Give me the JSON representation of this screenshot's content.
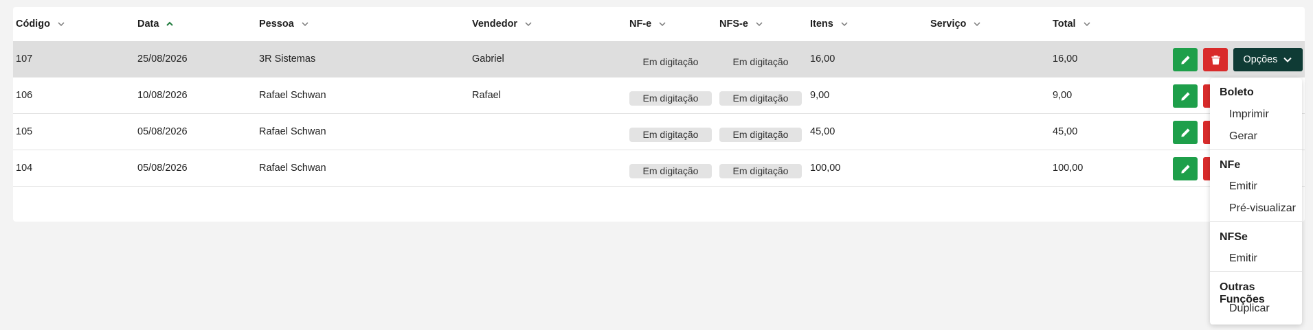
{
  "columns": {
    "codigo": "Código",
    "data": "Data",
    "pessoa": "Pessoa",
    "vendedor": "Vendedor",
    "nfe": "NF-e",
    "nfse": "NFS-e",
    "itens": "Itens",
    "servico": "Serviço",
    "total": "Total"
  },
  "sort": {
    "column": "data",
    "direction": "ascending"
  },
  "rows": [
    {
      "codigo": "107",
      "data": "25/08/2026",
      "pessoa": "3R Sistemas",
      "vendedor": "Gabriel",
      "nfe": "Em digitação",
      "nfse": "Em digitação",
      "itens": "16,00",
      "servico": "",
      "total": "16,00",
      "selected": true
    },
    {
      "codigo": "106",
      "data": "10/08/2026",
      "pessoa": "Rafael Schwan",
      "vendedor": "Rafael",
      "nfe": "Em digitação",
      "nfse": "Em digitação",
      "itens": "9,00",
      "servico": "",
      "total": "9,00"
    },
    {
      "codigo": "105",
      "data": "05/08/2026",
      "pessoa": "Rafael Schwan",
      "vendedor": "",
      "nfe": "Em digitação",
      "nfse": "Em digitação",
      "itens": "45,00",
      "servico": "",
      "total": "45,00"
    },
    {
      "codigo": "104",
      "data": "05/08/2026",
      "pessoa": "Rafael Schwan",
      "vendedor": "",
      "nfe": "Em digitação",
      "nfse": "Em digitação",
      "itens": "100,00",
      "servico": "",
      "total": "100,00"
    }
  ],
  "actions": {
    "edit_icon": "pencil-icon",
    "delete_icon": "trash-icon",
    "options_label": "Opções"
  },
  "options_menu": {
    "boleto": {
      "heading": "Boleto",
      "items": [
        "Imprimir",
        "Gerar"
      ]
    },
    "nfe": {
      "heading": "NFe",
      "items": [
        "Emitir",
        "Pré-visualizar"
      ]
    },
    "nfse": {
      "heading": "NFSe",
      "items": [
        "Emitir"
      ]
    },
    "outras": {
      "heading": "Outras Funções",
      "items": [
        "Duplicar"
      ]
    }
  },
  "colors": {
    "edit": "#1e9f4a",
    "delete": "#d92b2b",
    "options": "#0f3b35",
    "sort_accent": "#1e7a3c",
    "selected_row": "#dedede"
  }
}
